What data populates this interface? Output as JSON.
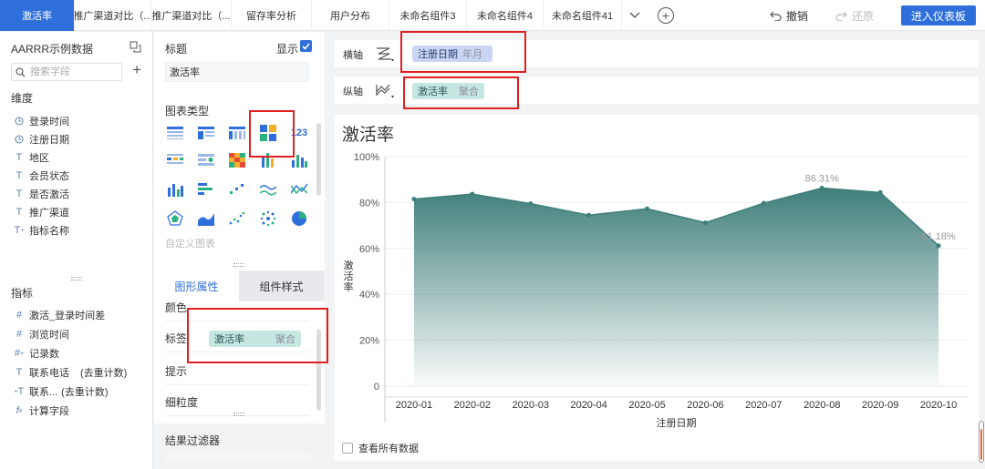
{
  "tabs": [
    {
      "label": "激活率",
      "active": true
    },
    {
      "label": "推广渠道对比（...",
      "active": false
    },
    {
      "label": "推广渠道对比（...",
      "active": false
    },
    {
      "label": "留存率分析",
      "active": false
    },
    {
      "label": "用户分布",
      "active": false
    },
    {
      "label": "未命名组件3",
      "active": false
    },
    {
      "label": "未命名组件4",
      "active": false
    },
    {
      "label": "未命名组件41",
      "active": false
    }
  ],
  "toolbar": {
    "undo": "撤销",
    "redo": "还原",
    "enter_dashboard": "进入仪表板"
  },
  "left": {
    "dataset": "AARRR示例数据",
    "search_placeholder": "搜索字段",
    "dimension_label": "维度",
    "dimensions": [
      {
        "icon": "clock-icon",
        "label": "登录时间"
      },
      {
        "icon": "clock-icon",
        "label": "注册日期"
      },
      {
        "icon": "text-type-icon",
        "label": "地区"
      },
      {
        "icon": "text-type-icon",
        "label": "会员状态"
      },
      {
        "icon": "text-type-icon",
        "label": "是否激活"
      },
      {
        "icon": "text-type-icon",
        "label": "推广渠道"
      },
      {
        "icon": "text-type-icon",
        "label": "指标名称"
      }
    ],
    "measure_label": "指标",
    "measures": [
      {
        "icon": "#",
        "label": "激活_登录时间差"
      },
      {
        "icon": "#",
        "label": "浏览时间"
      },
      {
        "icon": "#",
        "label": "记录数"
      },
      {
        "icon": "T",
        "label": "联系电话",
        "extra": "(去重计数)"
      },
      {
        "icon": "T",
        "label": "联系...",
        "extra": "(去重计数)"
      },
      {
        "icon": "fx",
        "label": "计算字段"
      }
    ]
  },
  "middle": {
    "title_label": "标题",
    "show_label": "显示",
    "title_value": "激活率",
    "chart_type_label": "图表类型",
    "custom_chart": "自定义图表",
    "tab_graph_props": "图形属性",
    "tab_component_style": "组件样式",
    "prop_color": "颜色",
    "prop_label": "标签",
    "prop_tooltip": "提示",
    "prop_granularity": "细粒度",
    "label_pill": {
      "name": "激活率",
      "agg": "聚合"
    },
    "result_filter": "结果过滤器"
  },
  "axes": {
    "x_label": "横轴",
    "x_pill": {
      "name": "注册日期",
      "agg": "年月"
    },
    "y_label": "纵轴",
    "y_pill": {
      "name": "激活率",
      "agg": "聚合"
    }
  },
  "chart_panel": {
    "title": "激活率",
    "see_all": "查看所有数据"
  },
  "chart_data": {
    "type": "area",
    "title": "激活率",
    "xlabel": "注册日期",
    "ylabel": "激活率",
    "categories": [
      "2020-01",
      "2020-02",
      "2020-03",
      "2020-04",
      "2020-05",
      "2020-06",
      "2020-07",
      "2020-08",
      "2020-09",
      "2020-10"
    ],
    "values": [
      81.5,
      83.7,
      79.5,
      74.5,
      77.3,
      71.2,
      79.7,
      86.31,
      84.4,
      61.18
    ],
    "ylim": [
      0,
      100
    ],
    "yticks": [
      "0",
      "20%",
      "40%",
      "60%",
      "80%",
      "100%"
    ],
    "data_labels": [
      {
        "index": 7,
        "text": "86.31%"
      },
      {
        "index": 9,
        "text": "61.18%"
      }
    ],
    "grid": true,
    "color": "#3f7f7a"
  }
}
